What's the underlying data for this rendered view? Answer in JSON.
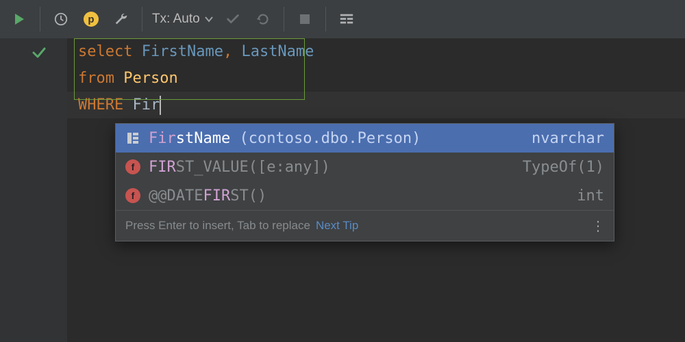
{
  "toolbar": {
    "tx_label": "Tx: Auto"
  },
  "code": {
    "line1": {
      "kw": "select",
      "sp1": " ",
      "id1": "FirstName",
      "comma": ",",
      "sp2": " ",
      "id2": "LastName"
    },
    "line2": {
      "kw": "from",
      "sp": " ",
      "tbl": "Person"
    },
    "line3": {
      "kw": "WHERE",
      "sp": " ",
      "typed": "Fir"
    }
  },
  "completion": {
    "items": [
      {
        "icon": "column",
        "match": "Fir",
        "rest": "stName",
        "context": " (contoso.dbo.Person)",
        "type": "nvarchar",
        "selected": true
      },
      {
        "icon": "function",
        "match": "FIR",
        "rest": "ST_VALUE([e:any])",
        "context": "",
        "type": "TypeOf(1)",
        "selected": false
      },
      {
        "icon": "function",
        "match_prefix": "@@DATE",
        "match": "FIR",
        "rest": "ST()",
        "context": "",
        "type": "int",
        "selected": false
      }
    ],
    "footer_hint": "Press Enter to insert, Tab to replace",
    "footer_link": "Next Tip"
  }
}
